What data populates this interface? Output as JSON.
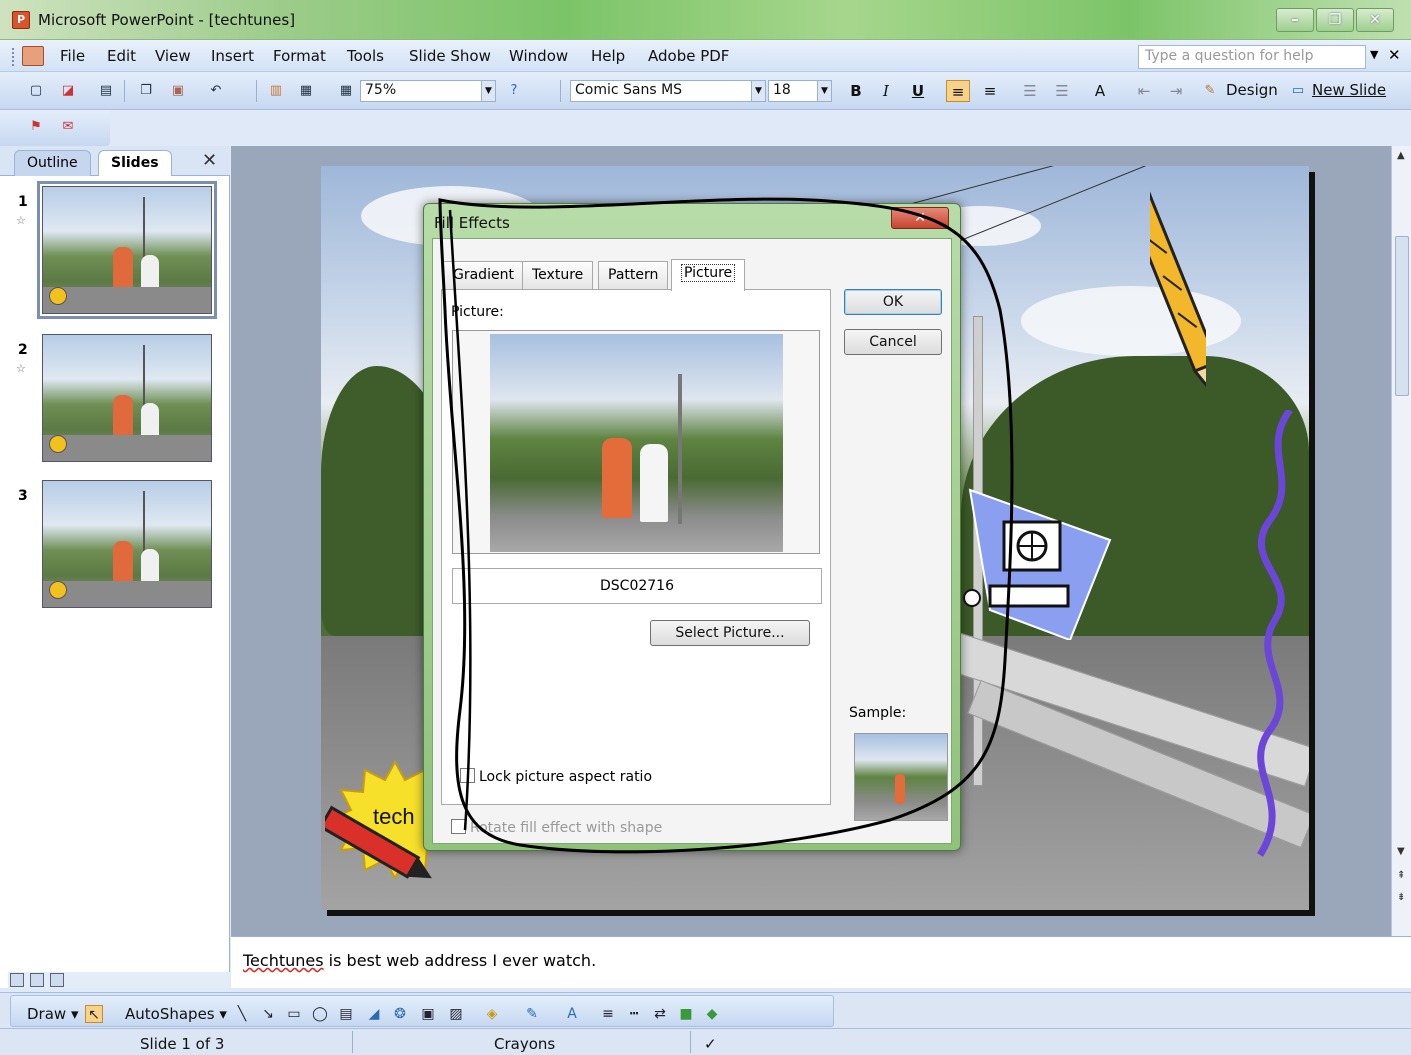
{
  "window": {
    "title": "Microsoft PowerPoint - [techtunes]",
    "controls": [
      "–",
      "❐",
      "✕"
    ]
  },
  "menu": {
    "items": [
      "File",
      "Edit",
      "View",
      "Insert",
      "Format",
      "Tools",
      "Slide Show",
      "Window",
      "Help",
      "Adobe PDF"
    ],
    "help_placeholder": "Type a question for help"
  },
  "toolbar": {
    "zoom": "75%",
    "font_name": "Comic Sans MS",
    "font_size": "18",
    "bold": "B",
    "italic": "I",
    "underline": "U",
    "design_label": "Design",
    "new_slide_label": "New Slide"
  },
  "left_pane": {
    "tabs": [
      "Outline",
      "Slides"
    ],
    "active_tab": "Slides",
    "close": "✕",
    "slides": [
      {
        "number": "1",
        "selected": true
      },
      {
        "number": "2",
        "selected": false
      },
      {
        "number": "3",
        "selected": false
      }
    ]
  },
  "dialog": {
    "title": "Fill Effects",
    "close": "✕",
    "tabs": [
      "Gradient",
      "Texture",
      "Pattern",
      "Picture"
    ],
    "active_tab": "Picture",
    "picture_label": "Picture:",
    "filename": "DSC02716",
    "select_picture_button": "Select Picture...",
    "ok_button": "OK",
    "cancel_button": "Cancel",
    "sample_label": "Sample:",
    "lock_aspect_label": "Lock picture aspect ratio",
    "rotate_label": "Rotate fill effect with shape"
  },
  "slide": {
    "badge_text": "tech"
  },
  "notes": {
    "text_underlined": "Techtunes",
    "text_rest": " is best web address I ever watch."
  },
  "draw_toolbar": {
    "draw_label": "Draw ▾",
    "autoshapes_label": "AutoShapes ▾"
  },
  "status": {
    "slide_info": "Slide 1 of 3",
    "design_name": "Crayons"
  },
  "colors": {
    "title_bar": "#7cc468",
    "toolbar": "#c6d8f1",
    "dialog_frame": "#8fc27a",
    "scribble": "#000000",
    "wavy_line": "#6b46d8"
  }
}
